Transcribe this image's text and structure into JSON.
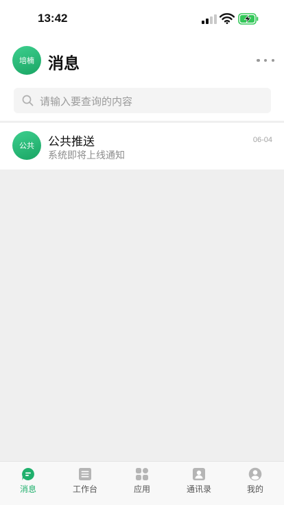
{
  "status_bar": {
    "time": "13:42",
    "icons": [
      "signal-icon",
      "wifi-icon",
      "battery-charging-icon"
    ]
  },
  "header": {
    "avatar_text": "培楠",
    "title": "消息",
    "more_icon": "more-dots-icon"
  },
  "search": {
    "placeholder": "请输入要查询的内容",
    "icon": "search-icon"
  },
  "conversations": [
    {
      "avatar_text": "公共",
      "title": "公共推送",
      "preview": "系统即将上线通知",
      "time": "06-04"
    }
  ],
  "tab_bar": {
    "tabs": [
      {
        "label": "消息",
        "icon": "message-icon",
        "active": true
      },
      {
        "label": "工作台",
        "icon": "workbench-icon",
        "active": false
      },
      {
        "label": "应用",
        "icon": "apps-grid-icon",
        "active": false
      },
      {
        "label": "通讯录",
        "icon": "contacts-icon",
        "active": false
      },
      {
        "label": "我的",
        "icon": "profile-icon",
        "active": false
      }
    ]
  },
  "colors": {
    "accent": "#1fb06c",
    "background": "#efefef",
    "inactive_icon": "#b5b5b5"
  }
}
